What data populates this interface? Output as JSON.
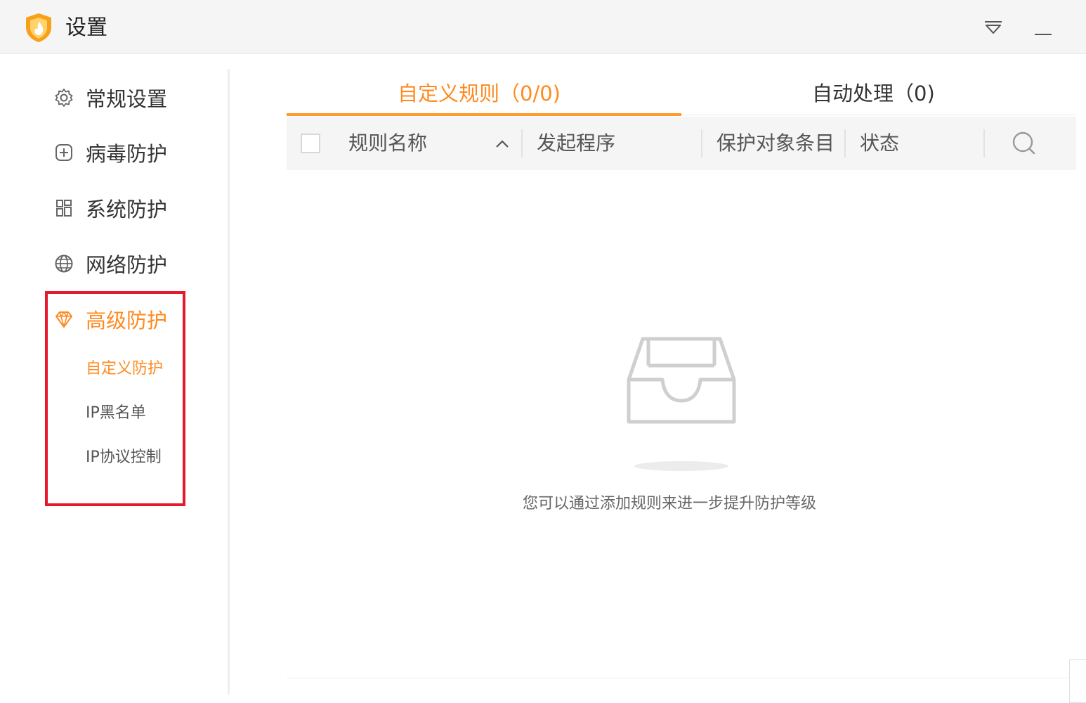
{
  "window": {
    "title": "设置"
  },
  "sidebar": {
    "items": [
      {
        "label": "常规设置",
        "icon": "gear-icon"
      },
      {
        "label": "病毒防护",
        "icon": "plus-square-icon"
      },
      {
        "label": "系统防护",
        "icon": "grid-icon"
      },
      {
        "label": "网络防护",
        "icon": "globe-icon"
      },
      {
        "label": "高级防护",
        "icon": "diamond-icon",
        "active": true
      }
    ],
    "subitems": [
      {
        "label": "自定义防护",
        "active": true
      },
      {
        "label": "IP黑名单"
      },
      {
        "label": "IP协议控制"
      }
    ]
  },
  "tabs": [
    {
      "label": "自定义规则（0/0)",
      "active": true
    },
    {
      "label": "自动处理（0)"
    }
  ],
  "table": {
    "columns": [
      "规则名称",
      "发起程序",
      "保护对象条目",
      "状态"
    ]
  },
  "empty_state": {
    "message": "您可以通过添加规则来进一步提升防护等级"
  },
  "colors": {
    "accent": "#ff8a1f",
    "highlight": "#e5192e"
  }
}
